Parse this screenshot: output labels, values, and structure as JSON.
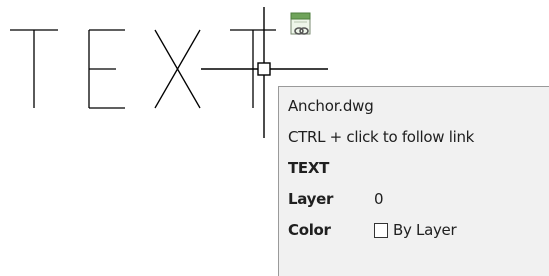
{
  "drawing": {
    "text_entity": "TEXT"
  },
  "tooltip": {
    "filename": "Anchor.dwg",
    "hint": "CTRL + click to follow link",
    "object_type": "TEXT",
    "properties": [
      {
        "label": "Layer",
        "value": "0"
      },
      {
        "label": "Color",
        "value": "By Layer"
      }
    ]
  },
  "icons": {
    "hyperlink": "hyperlink-icon",
    "crosshair": "crosshair-cursor-icon",
    "pickbox": "pickbox-icon",
    "color_swatch": "color-swatch-icon"
  },
  "colors": {
    "canvas_background": "#ffffff",
    "geometry_stroke": "#000000",
    "tooltip_background": "#f1f1f1",
    "tooltip_border": "#9a9a9a",
    "hyperlink_icon_green": "#6fa35a"
  }
}
